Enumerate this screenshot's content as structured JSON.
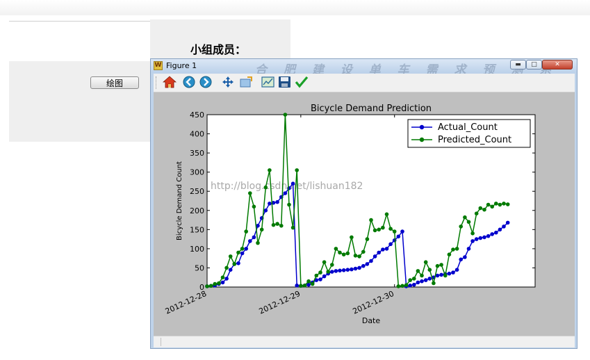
{
  "form": {
    "members_label": "小组成员：",
    "draw_button": "绘图"
  },
  "window": {
    "title": "Figure 1",
    "title_watermark": "合 肥 建 设 单 车 需 求 预 测 系 统",
    "watermark_url": "http://blog.csdn.net/lishuan182",
    "controls": [
      "minimize-icon",
      "maximize-icon",
      "close-icon"
    ]
  },
  "toolbar": {
    "buttons": [
      {
        "name": "home-icon"
      },
      {
        "name": "back-icon"
      },
      {
        "name": "forward-icon"
      },
      {
        "name": "pan-icon"
      },
      {
        "name": "zoom-icon"
      },
      {
        "name": "configure-subplots-icon"
      },
      {
        "name": "save-icon"
      },
      {
        "name": "check-icon"
      }
    ]
  },
  "chart_data": {
    "type": "line",
    "title": "Bicycle Demand Prediction",
    "xlabel": "Date",
    "ylabel": "Bicycle Demand Count",
    "ylim": [
      0,
      450
    ],
    "yticks": [
      0,
      50,
      100,
      150,
      200,
      250,
      300,
      350,
      400,
      450
    ],
    "xticks": [
      "2012-12-28",
      "2012-12-29",
      "2012-12-30"
    ],
    "x_start": "2012-12-28",
    "legend_position": "top-right",
    "grid": false,
    "colors": {
      "actual": "#0000cc",
      "predicted": "#007a00"
    },
    "series": [
      {
        "name": "Actual_Count",
        "segments": [
          {
            "x": [
              0,
              1,
              2,
              3,
              4,
              5,
              6,
              7,
              8,
              9,
              10,
              11,
              12,
              13,
              14,
              15,
              16,
              17,
              18,
              19,
              20,
              21,
              22,
              23
            ],
            "values": [
              2,
              3,
              4,
              8,
              12,
              22,
              45,
              60,
              62,
              88,
              100,
              120,
              130,
              160,
              180,
              200,
              218,
              220,
              222,
              235,
              245,
              258,
              270,
              4
            ]
          },
          {
            "x": [
              24,
              25,
              26,
              27,
              28,
              29,
              30,
              31,
              32,
              33,
              34,
              35,
              36,
              37,
              38,
              39,
              40,
              41,
              42,
              43,
              44,
              45,
              46,
              47
            ],
            "values": [
              3,
              4,
              6,
              12,
              18,
              20,
              28,
              35,
              40,
              42,
              43,
              44,
              45,
              46,
              48,
              50,
              55,
              60,
              68,
              80,
              90,
              98,
              100,
              112
            ]
          },
          {
            "x": [
              48,
              49,
              50,
              51,
              52,
              53,
              54,
              55,
              56,
              57,
              58,
              59,
              60,
              61,
              62,
              63,
              64,
              65,
              66,
              67,
              68,
              69,
              70,
              71
            ],
            "values": [
              122,
              132,
              145,
              2,
              4,
              6,
              12,
              15,
              18,
              22,
              25,
              30,
              32,
              34,
              35,
              38,
              45,
              72,
              78,
              100,
              120,
              125,
              128,
              130
            ]
          },
          {
            "x": [
              72,
              73,
              74,
              75,
              76,
              77
            ],
            "values": [
              133,
              138,
              142,
              150,
              158,
              168
            ]
          }
        ]
      },
      {
        "name": "Predicted_Count",
        "segments": [
          {
            "x": [
              0,
              1,
              2,
              3,
              4,
              5,
              6,
              7,
              8,
              9,
              10,
              11,
              12,
              13,
              14,
              15,
              16,
              17,
              18,
              19,
              20,
              21,
              22,
              23
            ],
            "values": [
              2,
              3,
              8,
              10,
              25,
              50,
              80,
              60,
              90,
              100,
              145,
              245,
              210,
              115,
              150,
              260,
              305,
              162,
              165,
              160,
              450,
              215,
              155,
              305
            ]
          },
          {
            "x": [
              24,
              25,
              26,
              27,
              28,
              29,
              30,
              31,
              32,
              33,
              34,
              35,
              36,
              37,
              38,
              39,
              40,
              41,
              42,
              43,
              44,
              45,
              46,
              47
            ],
            "values": [
              3,
              4,
              15,
              8,
              30,
              38,
              65,
              40,
              58,
              100,
              90,
              85,
              88,
              130,
              82,
              80,
              92,
              125,
              175,
              148,
              150,
              155,
              190,
              152
            ]
          },
          {
            "x": [
              48,
              49,
              50,
              51,
              52,
              53,
              54,
              55,
              56,
              57,
              58,
              59,
              60,
              61,
              62,
              63,
              64,
              65,
              66,
              67,
              68,
              69,
              70,
              71
            ],
            "values": [
              145,
              2,
              3,
              5,
              18,
              22,
              42,
              30,
              65,
              45,
              10,
              55,
              58,
              30,
              85,
              98,
              100,
              158,
              182,
              170,
              140,
              192,
              206,
              202
            ]
          },
          {
            "x": [
              72,
              73,
              74,
              75,
              76,
              77
            ],
            "values": [
              215,
              210,
              218,
              215,
              218,
              216
            ]
          }
        ]
      }
    ]
  }
}
